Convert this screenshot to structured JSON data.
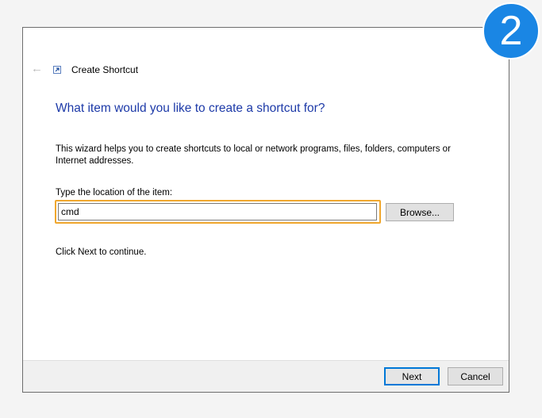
{
  "window": {
    "title": "Create Shortcut"
  },
  "wizard": {
    "heading": "What item would you like to create a shortcut for?",
    "description": "This wizard helps you to create shortcuts to local or network programs, files, folders, computers or Internet addresses.",
    "location_label": "Type the location of the item:",
    "location_value": "cmd",
    "browse_label": "Browse...",
    "continue_text": "Click Next to continue."
  },
  "footer": {
    "next_label": "Next",
    "cancel_label": "Cancel"
  },
  "annotation": {
    "step_number": "2",
    "badge_color": "#1a86e4",
    "highlight_color": "#f0a72e"
  },
  "colors": {
    "heading": "#1d3aa8",
    "focus_border": "#0078d7"
  },
  "icons": {
    "back": "back-arrow-icon",
    "shortcut": "shortcut-icon"
  }
}
